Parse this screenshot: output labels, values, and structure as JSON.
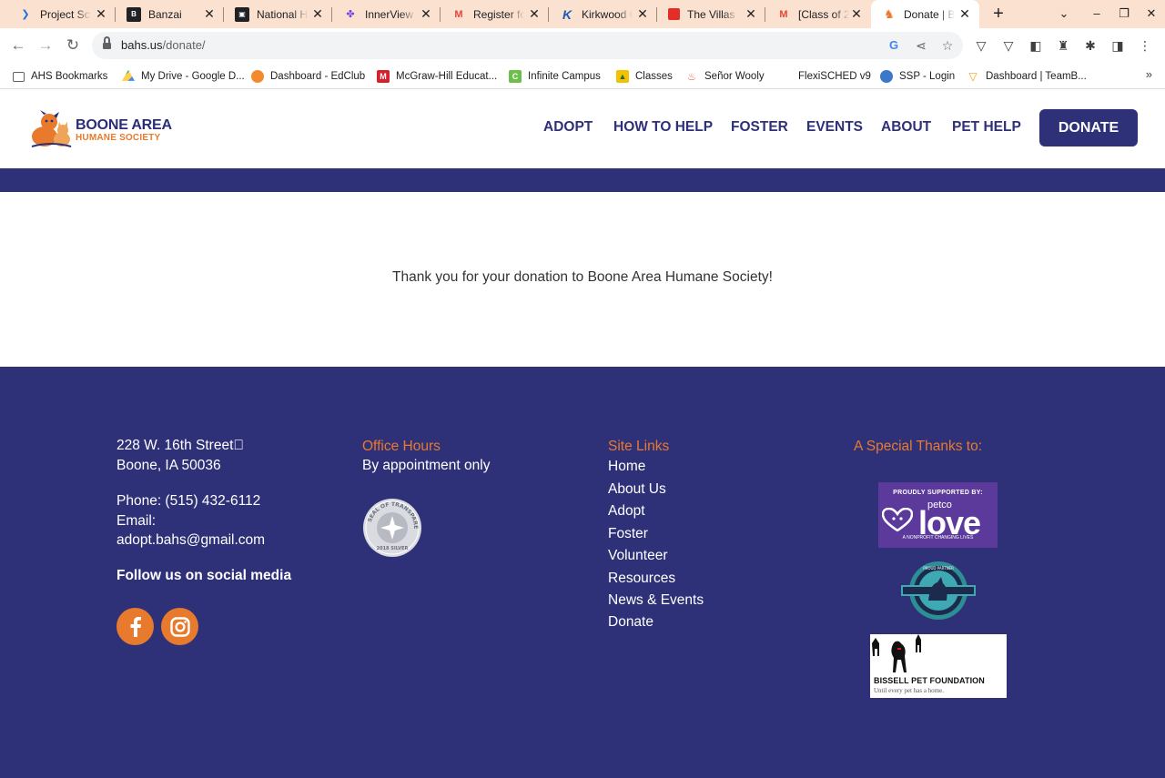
{
  "browser": {
    "tabs": [
      {
        "title": "Project Sch",
        "icon": "chevron-icon",
        "color": "#1a73e8"
      },
      {
        "title": "Banzai",
        "icon": "banzai-icon",
        "color": "#202124"
      },
      {
        "title": "National H",
        "icon": "badge-icon",
        "color": "#202124"
      },
      {
        "title": "InnerView",
        "icon": "innerview-icon",
        "color": "#7b3fe4"
      },
      {
        "title": "Register fo",
        "icon": "gmail-icon",
        "color": "#ea4335"
      },
      {
        "title": "Kirkwood C",
        "icon": "kirkwood-icon",
        "color": "#1a5bb8"
      },
      {
        "title": "The Villas",
        "icon": "villas-icon",
        "color": "#e52d27"
      },
      {
        "title": "[Class of 2",
        "icon": "gmail-icon",
        "color": "#ea4335"
      },
      {
        "title": "Donate | B",
        "icon": "bahs-icon",
        "color": "#e87a2d"
      }
    ],
    "new_tab": "+",
    "window_controls": {
      "tab_search": "⌄",
      "minimize": "–",
      "restore": "❐",
      "close": "✕"
    },
    "nav": {
      "back": "←",
      "forward": "→",
      "reload": "↻"
    },
    "url_domain": "bahs.us",
    "url_path": "/donate/",
    "omnibox_icons": {
      "google": "G",
      "share": "⋖",
      "star": "☆"
    },
    "extensions": {
      "brave": "▽",
      "shield": "▽",
      "media": "◧",
      "spy": "♜",
      "puzzle": "✱",
      "sidebar": "◨",
      "menu": "⋮"
    },
    "bookmarks": [
      {
        "label": "AHS Bookmarks",
        "icon": "folder-icon",
        "color": "#5f6368"
      },
      {
        "label": "My Drive - Google D...",
        "icon": "google-drive-icon",
        "color": "#1fa463"
      },
      {
        "label": "Dashboard - EdClub",
        "icon": "edclub-icon",
        "color": "#f28b30"
      },
      {
        "label": "McGraw-Hill Educat...",
        "icon": "mcgraw-hill-icon",
        "color": "#d6202b"
      },
      {
        "label": "Infinite Campus",
        "icon": "infinite-campus-icon",
        "color": "#6cc04a"
      },
      {
        "label": "Classes",
        "icon": "classes-icon",
        "color": "#f2c200"
      },
      {
        "label": "Señor Wooly",
        "icon": "senor-wooly-icon",
        "color": "#e2563b"
      },
      {
        "label": "FlexiSCHED v9",
        "icon": "",
        "color": ""
      },
      {
        "label": "SSP - Login",
        "icon": "ssp-icon",
        "color": "#3a78c9"
      },
      {
        "label": "Dashboard | TeamB...",
        "icon": "teamb-icon",
        "color": "#f39c12"
      }
    ],
    "bookmarks_more": "»"
  },
  "site": {
    "logo_line1": "BOONE AREA",
    "logo_line2": "HUMANE SOCIETY",
    "nav": [
      "ADOPT",
      "HOW TO HELP",
      "FOSTER",
      "EVENTS",
      "ABOUT",
      "PET HELP"
    ],
    "donate_label": "DONATE",
    "thank_you": "Thank you for your donation to Boone Area Humane Society!",
    "colors": {
      "brand_navy": "#2f3178",
      "brand_orange": "#e87a2d"
    }
  },
  "footer": {
    "address_line1": "228 W. 16th Street\u0000",
    "address_line2": "Boone, IA 50036",
    "phone": "Phone: (515) 432-6112",
    "email_label": "Email:",
    "email": "adopt.bahs@gmail.com",
    "follow": "Follow us on social media",
    "social": [
      "facebook-icon",
      "instagram-icon"
    ],
    "office_hours_title": "Office Hours",
    "office_hours": "By appointment only",
    "seal_text": "SEAL OF TRANSPARENCY",
    "seal_year": "2018 SILVER",
    "site_links_title": "Site Links",
    "site_links": [
      "Home",
      "About Us",
      "Adopt",
      "Foster",
      "Volunteer",
      "Resources",
      "News & Events",
      "Donate"
    ],
    "thanks_title": "A Special Thanks to:",
    "petco_top": "PROUDLY SUPPORTED BY:",
    "petco_brand": "petco",
    "petco_love": "love",
    "petco_bottom": "A NONPROFIT CHANGING LIVES",
    "badge_text": "PROUD PARTNER",
    "bissell_name": "BISSELL PET FOUNDATION",
    "bissell_tag": "Until every pet has a home."
  }
}
